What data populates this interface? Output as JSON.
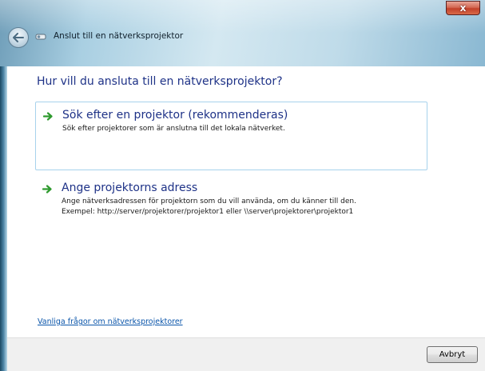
{
  "window": {
    "title": "Anslut till en nätverksprojektor",
    "close_label": "x"
  },
  "main": {
    "heading": "Hur vill du ansluta till en nätverksprojektor?",
    "options": [
      {
        "title": "Sök efter en projektor (rekommenderas)",
        "description": "Sök efter projektorer som är anslutna till det lokala nätverket."
      },
      {
        "title": "Ange projektorns adress",
        "description": "Ange nätverksadressen för projektorn som du vill använda, om du känner till den.",
        "example": "Exempel: http://server/projektorer/projektor1 eller \\\\server\\projektorer\\projektor1"
      }
    ],
    "help_link": "Vanliga frågor om nätverksprojektorer"
  },
  "footer": {
    "cancel_label": "Avbryt"
  },
  "icons": {
    "back": "back-arrow-icon",
    "app": "projector-icon",
    "option_arrow": "green-arrow-icon"
  },
  "colors": {
    "heading_blue": "#1e3287",
    "link_blue": "#0a55aa",
    "option_arrow_green": "#2e9a2e",
    "close_red": "#c2412a"
  }
}
